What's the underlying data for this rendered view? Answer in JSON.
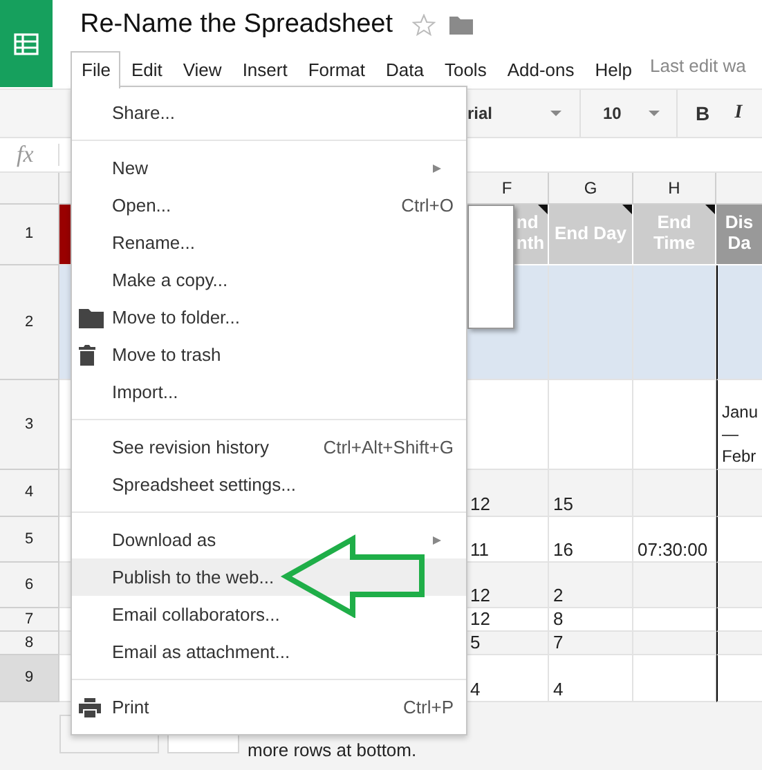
{
  "app": {
    "title": "Re-Name the Spreadsheet",
    "starred": false
  },
  "menu_bar": {
    "items": [
      {
        "label": "File",
        "open": true
      },
      {
        "label": "Edit",
        "open": false
      },
      {
        "label": "View",
        "open": false
      },
      {
        "label": "Insert",
        "open": false
      },
      {
        "label": "Format",
        "open": false
      },
      {
        "label": "Data",
        "open": false
      },
      {
        "label": "Tools",
        "open": false
      },
      {
        "label": "Add-ons",
        "open": false
      },
      {
        "label": "Help",
        "open": false
      }
    ],
    "status": "Last edit wa"
  },
  "toolbar": {
    "font": "rial",
    "font_size": "10",
    "bold": "B",
    "italic": "I"
  },
  "formula_bar": {
    "fx": "fx"
  },
  "sheet": {
    "columns": [
      "F",
      "G",
      "H"
    ],
    "rows": [
      {
        "number": "1",
        "kind": "header",
        "selected": false,
        "cells": {
          "f": "nd nth",
          "g": "End Day",
          "h": "End Time",
          "i": "Dis Da"
        }
      },
      {
        "number": "2",
        "kind": "highlight",
        "selected": false,
        "cells": {}
      },
      {
        "number": "3",
        "kind": "plain",
        "selected": false,
        "cells": {
          "i": "Janu\n—\nFebr"
        }
      },
      {
        "number": "4",
        "kind": "band",
        "selected": false,
        "cells": {
          "f": "12",
          "g": "15"
        }
      },
      {
        "number": "5",
        "kind": "plain",
        "selected": false,
        "cells": {
          "f": "11",
          "g": "16",
          "h": "07:30:00"
        }
      },
      {
        "number": "6",
        "kind": "band",
        "selected": false,
        "cells": {
          "f": "12",
          "g": "2"
        }
      },
      {
        "number": "7",
        "kind": "plain",
        "selected": false,
        "cells": {
          "f": "12",
          "g": "8"
        }
      },
      {
        "number": "8",
        "kind": "band",
        "selected": false,
        "cells": {
          "f": "5",
          "g": "7"
        }
      },
      {
        "number": "9",
        "kind": "plain",
        "selected": true,
        "cells": {
          "f": "4",
          "g": "4"
        }
      }
    ]
  },
  "footer": {
    "more_rows_text": "more rows at bottom."
  },
  "file_menu": {
    "items": [
      {
        "kind": "item",
        "label": "Share...",
        "selected": false,
        "has_submenu": false
      },
      {
        "kind": "separator"
      },
      {
        "kind": "item",
        "label": "New",
        "selected": false,
        "has_submenu": true
      },
      {
        "kind": "item",
        "label": "Open...",
        "shortcut": "Ctrl+O",
        "selected": false,
        "has_submenu": false
      },
      {
        "kind": "item",
        "label": "Rename...",
        "selected": false,
        "has_submenu": false
      },
      {
        "kind": "item",
        "label": "Make a copy...",
        "selected": false,
        "has_submenu": false
      },
      {
        "kind": "folder",
        "label": "Move to folder...",
        "selected": false,
        "has_submenu": false
      },
      {
        "kind": "trash",
        "label": "Move to trash",
        "selected": false,
        "has_submenu": false
      },
      {
        "kind": "item",
        "label": "Import...",
        "selected": false,
        "has_submenu": false
      },
      {
        "kind": "separator"
      },
      {
        "kind": "item",
        "label": "See revision history",
        "shortcut": "Ctrl+Alt+Shift+G",
        "selected": false,
        "has_submenu": false
      },
      {
        "kind": "item",
        "label": "Spreadsheet settings...",
        "selected": false,
        "has_submenu": false
      },
      {
        "kind": "separator"
      },
      {
        "kind": "item",
        "label": "Download as",
        "selected": false,
        "has_submenu": true
      },
      {
        "kind": "item",
        "label": "Publish to the web...",
        "selected": true,
        "has_submenu": false
      },
      {
        "kind": "item",
        "label": "Email collaborators...",
        "selected": false,
        "has_submenu": false
      },
      {
        "kind": "item",
        "label": "Email as attachment...",
        "selected": false,
        "has_submenu": false
      },
      {
        "kind": "separator"
      },
      {
        "kind": "printer",
        "label": "Print",
        "shortcut": "Ctrl+P",
        "selected": false,
        "has_submenu": false
      }
    ]
  }
}
